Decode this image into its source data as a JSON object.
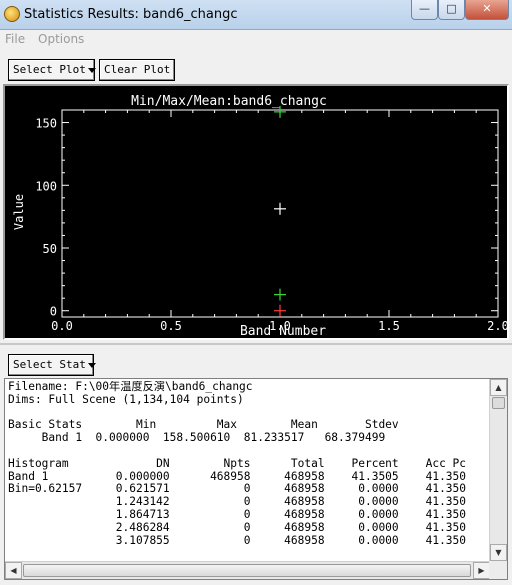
{
  "window": {
    "title": "Statistics Results: band6_changc",
    "minimize": "—",
    "maximize": "□",
    "close": "✕"
  },
  "menu": {
    "file": "File",
    "options": "Options"
  },
  "toolbar": {
    "select_plot": "Select Plot",
    "clear_plot": "Clear Plot"
  },
  "chart_data": {
    "type": "scatter",
    "title": "Min/Max/Mean:band6_changc",
    "xlabel": "Band Number",
    "ylabel": "Value",
    "xlim": [
      0.0,
      2.0
    ],
    "ylim": [
      -5,
      160
    ],
    "xticks": [
      "0.0",
      "0.5",
      "1.0",
      "1.5",
      "2.0"
    ],
    "yticks": [
      "0",
      "50",
      "100",
      "150"
    ],
    "background": "#000000",
    "axis_color": "#ffffff",
    "series": [
      {
        "name": "Min",
        "color": "#ff3b3b",
        "points": [
          [
            1.0,
            0.0
          ]
        ]
      },
      {
        "name": "Max",
        "color": "#3ad43a",
        "points": [
          [
            1.0,
            158.50061
          ]
        ]
      },
      {
        "name": "Mean",
        "color": "#ffffff",
        "points": [
          [
            1.0,
            81.233517
          ]
        ]
      },
      {
        "name": "Stdev",
        "color": "#3ad43a",
        "points": [
          [
            1.0,
            12.85
          ]
        ]
      }
    ]
  },
  "stats_panel": {
    "select_stat": "Select Stat"
  },
  "stats": {
    "filename_line": "Filename: F:\\00年温度反演\\band6_changc",
    "dims_line": "Dims: Full Scene (1,134,104 points)",
    "basic_header": "Basic Stats        Min         Max        Mean       Stdev",
    "basic_row": "     Band 1  0.000000  158.500610  81.233517   68.379499",
    "hist_header": "Histogram             DN        Npts      Total    Percent    Acc Pc",
    "hist_rows": [
      "Band 1          0.000000      468958     468958    41.3505    41.350",
      "Bin=0.62157     0.621571           0     468958     0.0000    41.350",
      "                1.243142           0     468958     0.0000    41.350",
      "                1.864713           0     468958     0.0000    41.350",
      "                2.486284           0     468958     0.0000    41.350",
      "                3.107855           0     468958     0.0000    41.350"
    ]
  }
}
